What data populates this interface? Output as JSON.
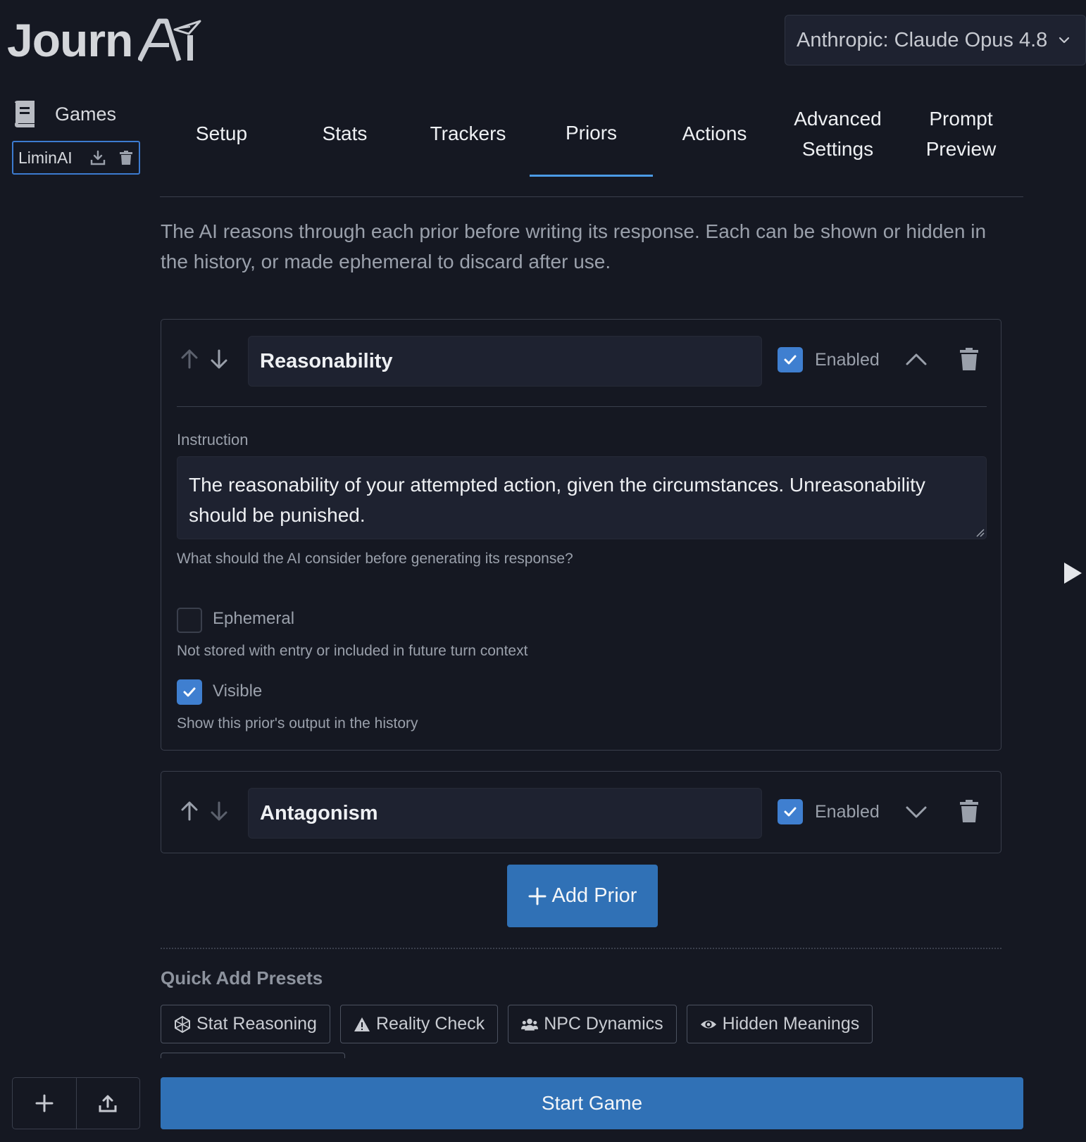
{
  "app": {
    "logo_text": "Journ",
    "logo_ai": "Ai"
  },
  "model_select": {
    "value": "Anthropic: Claude Opus 4.8",
    "icon": "chevron-down-icon"
  },
  "sidebar": {
    "games_label": "Games",
    "games_icon": "book-icon",
    "items": [
      {
        "label": "LiminAI",
        "icons": [
          "download-icon",
          "trash-icon"
        ]
      }
    ],
    "bottom_buttons": [
      {
        "icon": "plus-icon"
      },
      {
        "icon": "upload-icon"
      }
    ]
  },
  "tabs": [
    {
      "label": "Setup",
      "active": false
    },
    {
      "label": "Stats",
      "active": false
    },
    {
      "label": "Trackers",
      "active": false
    },
    {
      "label": "Priors",
      "active": true
    },
    {
      "label": "Actions",
      "active": false
    },
    {
      "label": "Advanced\nSettings",
      "active": false
    },
    {
      "label": "Prompt\nPreview",
      "active": false
    }
  ],
  "intro": "The AI reasons through each prior before writing its response. Each can be shown or hidden in the history, or made ephemeral to discard after use.",
  "priors": [
    {
      "name": "Reasonability",
      "enabled": true,
      "enabled_label": "Enabled",
      "expanded": true,
      "instruction_label": "Instruction",
      "instruction": "The reasonability of your attempted action, given the circumstances. Unreasonability should be punished.",
      "instruction_help": "What should the AI consider before generating its response?",
      "ephemeral_label": "Ephemeral",
      "ephemeral": false,
      "ephemeral_help": "Not stored with entry or included in future turn context",
      "visible_label": "Visible",
      "visible": true,
      "visible_help": "Show this prior's output in the history"
    },
    {
      "name": "Antagonism",
      "enabled": true,
      "enabled_label": "Enabled",
      "expanded": false
    }
  ],
  "add_prior_label": "Add Prior",
  "quick_add": {
    "title": "Quick Add Presets",
    "presets": [
      {
        "label": "Stat Reasoning",
        "icon": "dice-icon"
      },
      {
        "label": "Reality Check",
        "icon": "warning-icon"
      },
      {
        "label": "NPC Dynamics",
        "icon": "users-icon"
      },
      {
        "label": "Hidden Meanings",
        "icon": "eye-icon"
      }
    ]
  },
  "start_game_label": "Start Game",
  "colors": {
    "background": "#151822",
    "accent": "#3071b6",
    "checkbox": "#3f7fd0",
    "active_tab": "#4b9be6"
  }
}
